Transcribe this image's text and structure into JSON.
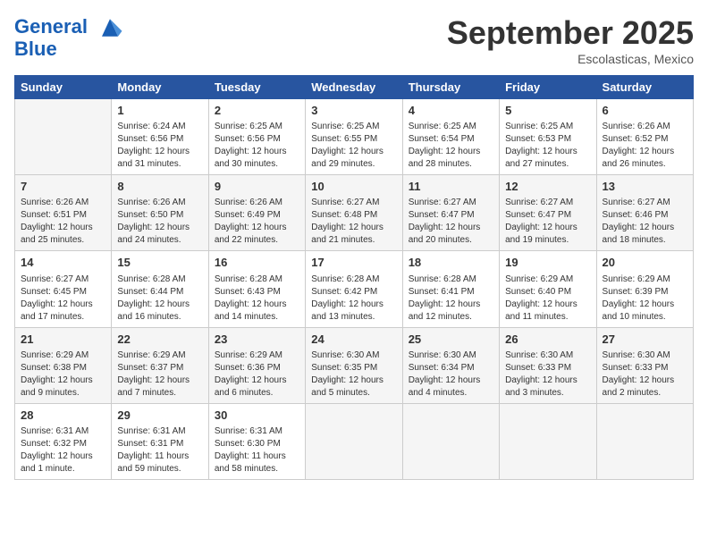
{
  "header": {
    "logo_line1": "General",
    "logo_line2": "Blue",
    "month": "September 2025",
    "location": "Escolasticas, Mexico"
  },
  "weekdays": [
    "Sunday",
    "Monday",
    "Tuesday",
    "Wednesday",
    "Thursday",
    "Friday",
    "Saturday"
  ],
  "weeks": [
    [
      {
        "day": "",
        "info": ""
      },
      {
        "day": "1",
        "info": "Sunrise: 6:24 AM\nSunset: 6:56 PM\nDaylight: 12 hours\nand 31 minutes."
      },
      {
        "day": "2",
        "info": "Sunrise: 6:25 AM\nSunset: 6:56 PM\nDaylight: 12 hours\nand 30 minutes."
      },
      {
        "day": "3",
        "info": "Sunrise: 6:25 AM\nSunset: 6:55 PM\nDaylight: 12 hours\nand 29 minutes."
      },
      {
        "day": "4",
        "info": "Sunrise: 6:25 AM\nSunset: 6:54 PM\nDaylight: 12 hours\nand 28 minutes."
      },
      {
        "day": "5",
        "info": "Sunrise: 6:25 AM\nSunset: 6:53 PM\nDaylight: 12 hours\nand 27 minutes."
      },
      {
        "day": "6",
        "info": "Sunrise: 6:26 AM\nSunset: 6:52 PM\nDaylight: 12 hours\nand 26 minutes."
      }
    ],
    [
      {
        "day": "7",
        "info": "Sunrise: 6:26 AM\nSunset: 6:51 PM\nDaylight: 12 hours\nand 25 minutes."
      },
      {
        "day": "8",
        "info": "Sunrise: 6:26 AM\nSunset: 6:50 PM\nDaylight: 12 hours\nand 24 minutes."
      },
      {
        "day": "9",
        "info": "Sunrise: 6:26 AM\nSunset: 6:49 PM\nDaylight: 12 hours\nand 22 minutes."
      },
      {
        "day": "10",
        "info": "Sunrise: 6:27 AM\nSunset: 6:48 PM\nDaylight: 12 hours\nand 21 minutes."
      },
      {
        "day": "11",
        "info": "Sunrise: 6:27 AM\nSunset: 6:47 PM\nDaylight: 12 hours\nand 20 minutes."
      },
      {
        "day": "12",
        "info": "Sunrise: 6:27 AM\nSunset: 6:47 PM\nDaylight: 12 hours\nand 19 minutes."
      },
      {
        "day": "13",
        "info": "Sunrise: 6:27 AM\nSunset: 6:46 PM\nDaylight: 12 hours\nand 18 minutes."
      }
    ],
    [
      {
        "day": "14",
        "info": "Sunrise: 6:27 AM\nSunset: 6:45 PM\nDaylight: 12 hours\nand 17 minutes."
      },
      {
        "day": "15",
        "info": "Sunrise: 6:28 AM\nSunset: 6:44 PM\nDaylight: 12 hours\nand 16 minutes."
      },
      {
        "day": "16",
        "info": "Sunrise: 6:28 AM\nSunset: 6:43 PM\nDaylight: 12 hours\nand 14 minutes."
      },
      {
        "day": "17",
        "info": "Sunrise: 6:28 AM\nSunset: 6:42 PM\nDaylight: 12 hours\nand 13 minutes."
      },
      {
        "day": "18",
        "info": "Sunrise: 6:28 AM\nSunset: 6:41 PM\nDaylight: 12 hours\nand 12 minutes."
      },
      {
        "day": "19",
        "info": "Sunrise: 6:29 AM\nSunset: 6:40 PM\nDaylight: 12 hours\nand 11 minutes."
      },
      {
        "day": "20",
        "info": "Sunrise: 6:29 AM\nSunset: 6:39 PM\nDaylight: 12 hours\nand 10 minutes."
      }
    ],
    [
      {
        "day": "21",
        "info": "Sunrise: 6:29 AM\nSunset: 6:38 PM\nDaylight: 12 hours\nand 9 minutes."
      },
      {
        "day": "22",
        "info": "Sunrise: 6:29 AM\nSunset: 6:37 PM\nDaylight: 12 hours\nand 7 minutes."
      },
      {
        "day": "23",
        "info": "Sunrise: 6:29 AM\nSunset: 6:36 PM\nDaylight: 12 hours\nand 6 minutes."
      },
      {
        "day": "24",
        "info": "Sunrise: 6:30 AM\nSunset: 6:35 PM\nDaylight: 12 hours\nand 5 minutes."
      },
      {
        "day": "25",
        "info": "Sunrise: 6:30 AM\nSunset: 6:34 PM\nDaylight: 12 hours\nand 4 minutes."
      },
      {
        "day": "26",
        "info": "Sunrise: 6:30 AM\nSunset: 6:33 PM\nDaylight: 12 hours\nand 3 minutes."
      },
      {
        "day": "27",
        "info": "Sunrise: 6:30 AM\nSunset: 6:33 PM\nDaylight: 12 hours\nand 2 minutes."
      }
    ],
    [
      {
        "day": "28",
        "info": "Sunrise: 6:31 AM\nSunset: 6:32 PM\nDaylight: 12 hours\nand 1 minute."
      },
      {
        "day": "29",
        "info": "Sunrise: 6:31 AM\nSunset: 6:31 PM\nDaylight: 11 hours\nand 59 minutes."
      },
      {
        "day": "30",
        "info": "Sunrise: 6:31 AM\nSunset: 6:30 PM\nDaylight: 11 hours\nand 58 minutes."
      },
      {
        "day": "",
        "info": ""
      },
      {
        "day": "",
        "info": ""
      },
      {
        "day": "",
        "info": ""
      },
      {
        "day": "",
        "info": ""
      }
    ]
  ]
}
